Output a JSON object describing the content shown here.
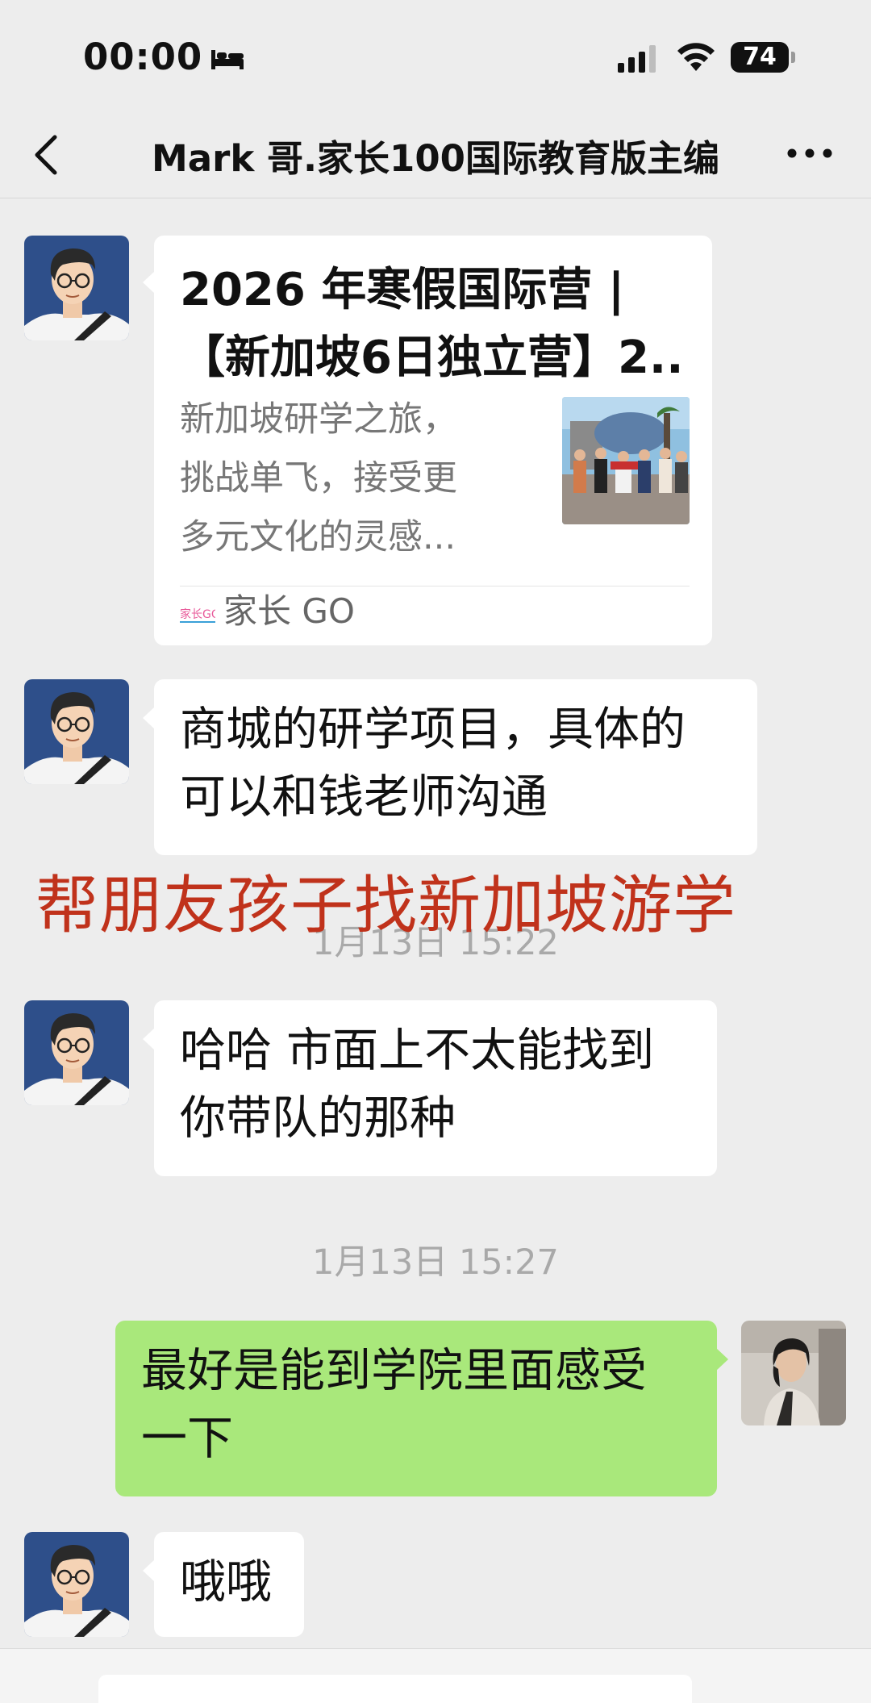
{
  "status_bar": {
    "time": "00:00",
    "battery": "74",
    "icons": [
      "bed-icon",
      "signal-icon",
      "wifi-icon",
      "battery-icon"
    ]
  },
  "nav": {
    "title": "Mark 哥.家长100国际教育版主编",
    "icons": [
      "back-arrow-icon",
      "more-icon"
    ]
  },
  "messages": {
    "link_card": {
      "title_line1": "2026 年寒假国际营 |",
      "title_line2": "【新加坡6日独立营】2...",
      "desc_line1": "新加坡研学之旅，",
      "desc_line2": "挑战单飞，接受更",
      "desc_line3": "多元文化的灵感...",
      "source": "家长 GO",
      "source_logo_text": "家长GO"
    },
    "msg1_line1": "商城的研学项目，具体的",
    "msg1_line2": "可以和钱老师沟通",
    "overlay_caption": "帮朋友孩子找新加坡游学",
    "ts1": "1月13日 15:22",
    "msg2_line1": "哈哈 市面上不太能找到",
    "msg2_line2": "你带队的那种",
    "ts2": "1月13日 15:27",
    "msg3_line1": "最好是能到学院里面感受",
    "msg3_line2": "一下",
    "msg4": "哦哦"
  },
  "colors": {
    "background": "#ededed",
    "sent_bubble": "#a9e87b",
    "received_bubble": "#ffffff",
    "caption_red": "#c0321b",
    "timestamp": "#a9a9a9"
  }
}
